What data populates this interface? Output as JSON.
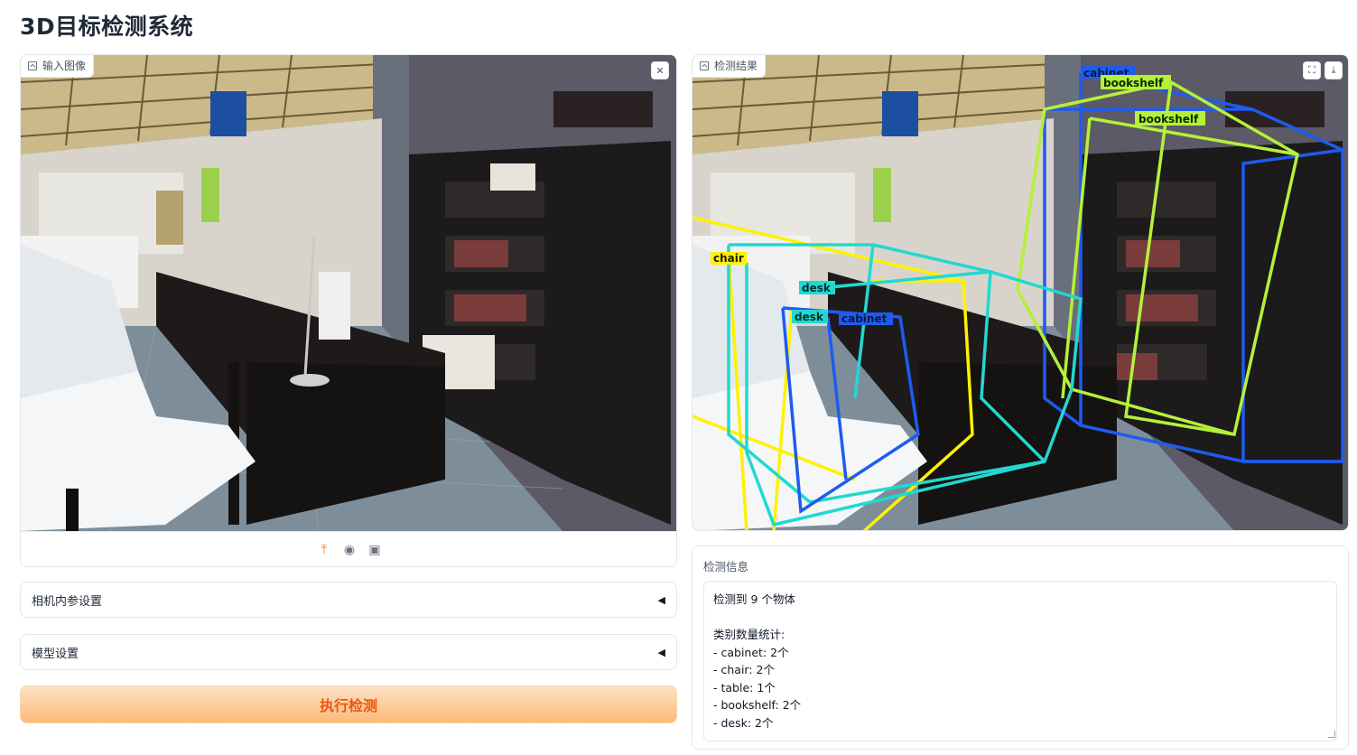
{
  "app": {
    "title": "3D目标检测系统"
  },
  "input_image": {
    "label": "输入图像",
    "close_icon": "✕"
  },
  "output_image": {
    "label": "检测结果",
    "fullscreen_icon": "⛶",
    "download_icon": "⤓",
    "boxes": [
      {
        "label": "cabinet",
        "color": "#1e5bf0"
      },
      {
        "label": "bookshelf",
        "color": "#b5f03a"
      },
      {
        "label": "bookshelf",
        "color": "#b5f03a"
      },
      {
        "label": "chair",
        "color": "#fff200"
      },
      {
        "label": "desk",
        "color": "#22d8d0"
      },
      {
        "label": "desk",
        "color": "#22d8d0"
      },
      {
        "label": "cabinet",
        "color": "#1e5bf0"
      }
    ]
  },
  "sources": [
    "upload-icon",
    "webcam-icon",
    "clipboard-icon"
  ],
  "accordions": {
    "camera": {
      "label": "相机内参设置",
      "caret": "◀"
    },
    "model": {
      "label": "模型设置",
      "caret": "◀"
    }
  },
  "run_button": {
    "label": "执行检测"
  },
  "info": {
    "label": "检测信息",
    "text": "检测到 9 个物体\n\n类别数量统计:\n- cabinet: 2个\n- chair: 2个\n- table: 1个\n- bookshelf: 2个\n- desk: 2个"
  },
  "colors": {
    "accent": "#f97316",
    "button_bg": "#fdb97a",
    "button_text": "#ea580c"
  }
}
